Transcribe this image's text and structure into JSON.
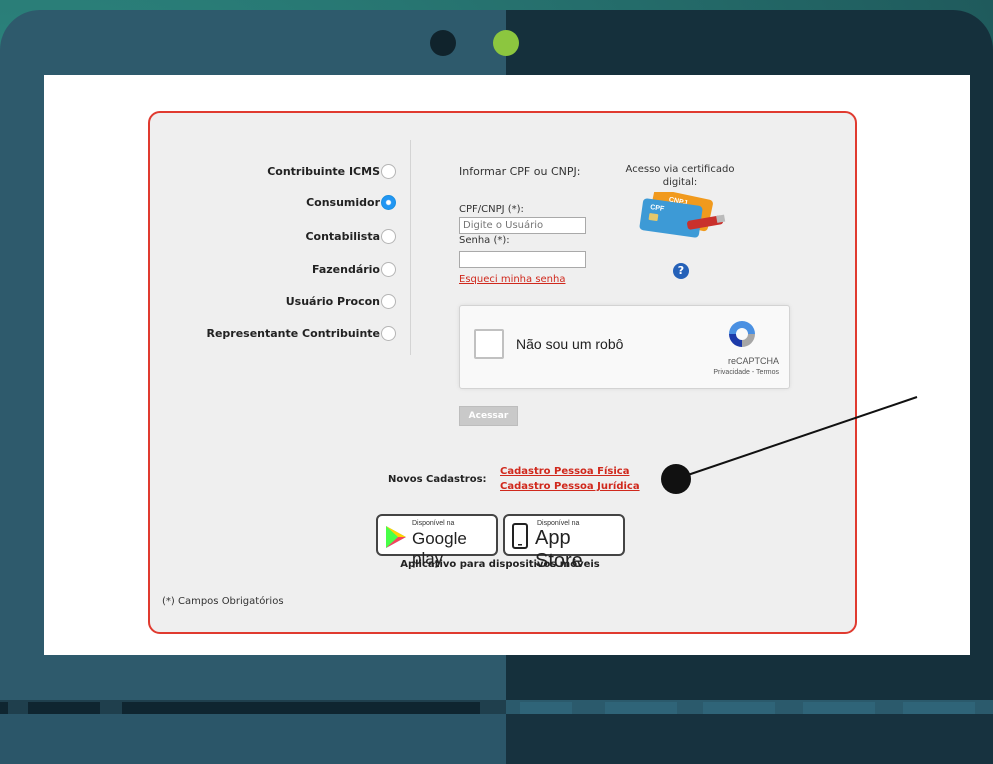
{
  "login": {
    "roles": [
      {
        "label": "Contribuinte ICMS",
        "selected": false
      },
      {
        "label": "Consumidor",
        "selected": true
      },
      {
        "label": "Contabilista",
        "selected": false
      },
      {
        "label": "Fazendário",
        "selected": false
      },
      {
        "label": "Usuário Procon",
        "selected": false
      },
      {
        "label": "Representante Contribuinte",
        "selected": false
      }
    ],
    "informar_label": "Informar CPF ou CNPJ:",
    "certificado_label": "Acesso via certificado digital:",
    "cpf_label": "CPF/CNPJ (*):",
    "cpf_placeholder": "Digite o Usuário",
    "senha_label": "Senha (*):",
    "senha_value": "",
    "forgot_link": "Esqueci minha senha",
    "acessar_button": "Acessar",
    "captcha": {
      "label": "Não sou um robô",
      "brand": "reCAPTCHA",
      "links": "Privacidade - Termos"
    },
    "novos_cadastros_label": "Novos Cadastros:",
    "cadastro_pf": "Cadastro Pessoa Física",
    "cadastro_pj": "Cadastro Pessoa Jurídica",
    "google_play": {
      "small": "Disponível na",
      "big": "Google play"
    },
    "app_store": {
      "small": "Disponível na",
      "big": "App Store"
    },
    "apps_caption": "Aplicativo para dispositivos móveis",
    "required_note": "(*) Campos Obrigatórios",
    "card_labels": [
      "CNPJ",
      "CPF"
    ]
  },
  "colors": {
    "accent_red": "#e03a2f",
    "radio_selected": "#2196f3",
    "laptop_dark": "#15303c",
    "laptop_light": "#2e5a6c",
    "camera_green": "#8cc63f"
  },
  "icons": [
    "help-question-icon",
    "certificate-cards-icon",
    "recaptcha-logo-icon",
    "google-play-triangle-icon",
    "phone-icon"
  ]
}
